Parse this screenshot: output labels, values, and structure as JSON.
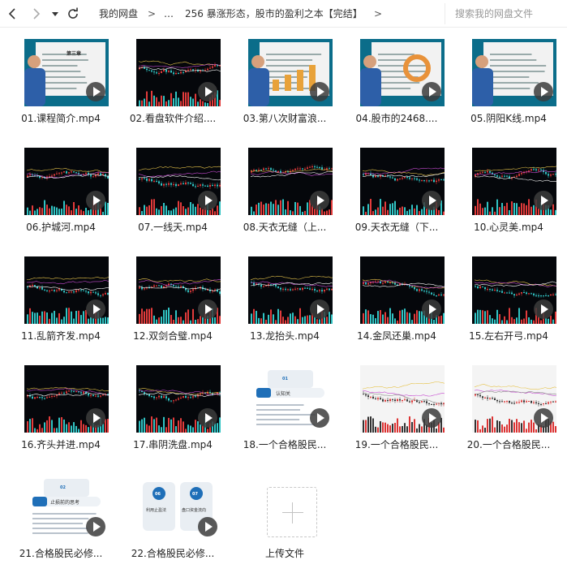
{
  "nav": {
    "breadcrumbs": [
      "我的网盘",
      "…",
      "256  暴涨形态，股市的盈利之本【完结】"
    ],
    "separator": ">",
    "search_placeholder": "搜索我的网盘文件"
  },
  "files": [
    {
      "name": "01.课程简介.mp4",
      "style": "presenter"
    },
    {
      "name": "02.看盘软件介绍....",
      "style": "chart"
    },
    {
      "name": "03.第八次财富浪...",
      "style": "presenter"
    },
    {
      "name": "04.股市的2468....",
      "style": "presenter"
    },
    {
      "name": "05.阴阳K线.mp4",
      "style": "presenter"
    },
    {
      "name": "06.护城河.mp4",
      "style": "chart"
    },
    {
      "name": "07.一线天.mp4",
      "style": "chart"
    },
    {
      "name": "08.天衣无缝（上...",
      "style": "chart"
    },
    {
      "name": "09.天衣无缝（下...",
      "style": "chart"
    },
    {
      "name": "10.心灵美.mp4",
      "style": "chart"
    },
    {
      "name": "11.乱箭齐发.mp4",
      "style": "chart"
    },
    {
      "name": "12.双剑合璧.mp4",
      "style": "chart"
    },
    {
      "name": "13.龙抬头.mp4",
      "style": "chart"
    },
    {
      "name": "14.金凤还巢.mp4",
      "style": "chart"
    },
    {
      "name": "15.左右开弓.mp4",
      "style": "chart"
    },
    {
      "name": "16.齐头并进.mp4",
      "style": "chart"
    },
    {
      "name": "17.串阴洗盘.mp4",
      "style": "chart"
    },
    {
      "name": "18.一个合格股民...",
      "style": "slide"
    },
    {
      "name": "19.一个合格股民...",
      "style": "whitechart"
    },
    {
      "name": "20.一个合格股民...",
      "style": "whitechart"
    },
    {
      "name": "21.合格股民必修...",
      "style": "slide"
    },
    {
      "name": "22.合格股民必修...",
      "style": "slide"
    }
  ],
  "upload": {
    "label": "上传文件"
  },
  "thumb_text": {
    "ch3": "第三章",
    "slide18": "认知关",
    "slide18_num": "01",
    "slide21": "止损前的思考",
    "slide21_num": "02",
    "slide22a": "利用止盈法",
    "slide22b": "盘口资金流向",
    "slide22_num1": "06",
    "slide22_num2": "07"
  },
  "colors": {
    "play_overlay": "#3c3c3c",
    "divider": "#ececec"
  }
}
